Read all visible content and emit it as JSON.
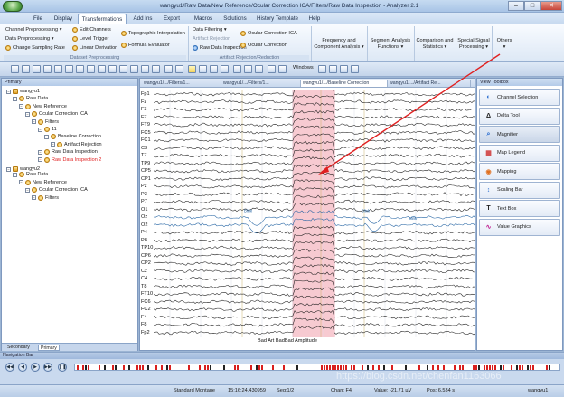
{
  "window": {
    "title": "wangyu1/Raw Data/New Reference/Ocular Correction ICA/Filters/Raw Data Inspection - Analyzer 2.1"
  },
  "menu": [
    {
      "label": "File"
    },
    {
      "label": "Display"
    },
    {
      "label": "Transformations",
      "active": true
    },
    {
      "label": "Add Ins"
    },
    {
      "label": "Export"
    },
    {
      "label": "Macros"
    },
    {
      "label": "Solutions"
    },
    {
      "label": "History Template"
    },
    {
      "label": "Help"
    }
  ],
  "ribbon": {
    "col1": [
      "Channel Preprocessing",
      "Data Preprocessing",
      "Change Sampling Rate"
    ],
    "col2": [
      "Edit Channels",
      "Level Trigger",
      "Linear Derivation"
    ],
    "col3": [
      "Topographic Interpolation",
      "Formula Evaluator"
    ],
    "group1_caption": "Dataset Preprocessing",
    "col4": [
      "Data Filtering",
      "Artifact Rejection",
      "Raw Data Inspection"
    ],
    "col5": [
      "Ocular Correction ICA",
      "Ocular Correction"
    ],
    "group2_caption": "Artifact Rejection/Reduction",
    "big": [
      {
        "line1": "Frequency and",
        "line2": "Component Analysis"
      },
      {
        "line1": "Segment Analysis",
        "line2": "Functions"
      },
      {
        "line1": "Comparison and",
        "line2": "Statistics"
      },
      {
        "line1": "Special Signal",
        "line2": "Processing"
      },
      {
        "line1": "Others",
        "line2": ""
      }
    ]
  },
  "toolbar": {
    "windows_label": "Windows"
  },
  "left_panel": {
    "title": "Primary",
    "tree": [
      {
        "label": "wangyu1",
        "level": 0,
        "kind": "root"
      },
      {
        "label": "Raw Data",
        "level": 1
      },
      {
        "label": "New Reference",
        "level": 2
      },
      {
        "label": "Ocular Correction ICA",
        "level": 3
      },
      {
        "label": "Filters",
        "level": 4
      },
      {
        "label": "11",
        "level": 5
      },
      {
        "label": "Baseline Correction",
        "level": 6
      },
      {
        "label": "Artifact Rejection",
        "level": 7
      },
      {
        "label": "Raw Data Inspection",
        "level": 5
      },
      {
        "label": "Raw Data Inspection 2",
        "level": 5,
        "red": true
      },
      {
        "label": "wangyu2",
        "level": 0,
        "kind": "root"
      },
      {
        "label": "Raw Data",
        "level": 1
      },
      {
        "label": "New Reference",
        "level": 2
      },
      {
        "label": "Ocular Correction ICA",
        "level": 3
      },
      {
        "label": "Filters",
        "level": 4
      }
    ],
    "tabs": {
      "secondary": "Secondary",
      "primary": "Primary"
    }
  },
  "signal": {
    "tabs": [
      "wangyu1/.../Filters/1...",
      "wangyu1/.../Filters/1...",
      "wangyu1/.../Baseline Correction",
      "wangyu1/.../Artifact Re..."
    ],
    "channels": [
      "Fp1",
      "Fz",
      "F3",
      "F7",
      "FT9",
      "FC5",
      "FC1",
      "C3",
      "T7",
      "TP9",
      "CP5",
      "CP1",
      "Pz",
      "P3",
      "P7",
      "O1",
      "Oz",
      "O2",
      "P4",
      "P8",
      "TP10",
      "CP6",
      "CP2",
      "Cz",
      "C4",
      "T8",
      "FT10",
      "FC6",
      "FC2",
      "F4",
      "F8",
      "Fp2"
    ],
    "blink_label": "Blink",
    "bottom_markers": "Bad Art BadBad Amplitude"
  },
  "right_panel": {
    "title": "View Toolbox",
    "tools": [
      {
        "label": "Channel Selection",
        "icon": "channel-selection-icon"
      },
      {
        "label": "Delta Tool",
        "icon": "delta-tool-icon"
      },
      {
        "label": "Magnifier",
        "icon": "magnifier-icon",
        "selected": true
      },
      {
        "label": "Map Legend",
        "icon": "map-legend-icon"
      },
      {
        "label": "Mapping",
        "icon": "mapping-icon"
      },
      {
        "label": "Scaling Bar",
        "icon": "scaling-bar-icon"
      },
      {
        "label": "Text Box",
        "icon": "text-box-icon"
      },
      {
        "label": "Value Graphics",
        "icon": "value-graphics-icon"
      }
    ]
  },
  "navigation": {
    "title": "Navigation Bar"
  },
  "status": {
    "montage": "Standard Montage",
    "time": "15:16:24.430959",
    "seg": "Seg:1/2",
    "chan": "Chan: F4",
    "value": "Value: -21.71 µV",
    "pos": "Pos: 6,534 s",
    "user": "wangyu1"
  },
  "watermark": "https://blog.csdn.net/chenfan1163066",
  "colors": {
    "artifact_band": "#f4b8c2",
    "artifact_band_edge": "#e07a8e",
    "arrow": "#e02020"
  }
}
